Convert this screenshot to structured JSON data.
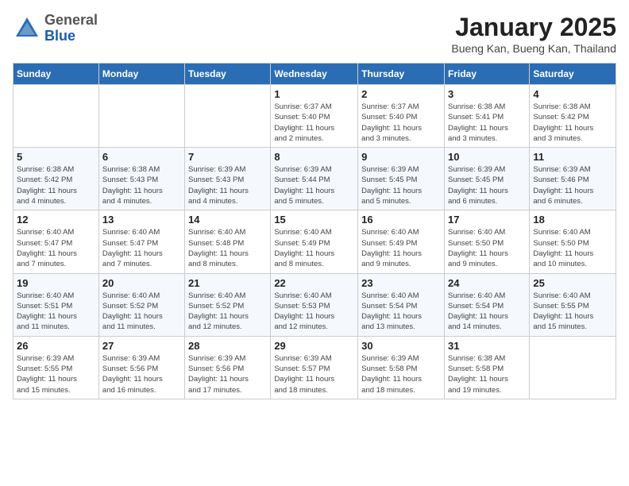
{
  "header": {
    "logo_general": "General",
    "logo_blue": "Blue",
    "month_title": "January 2025",
    "location": "Bueng Kan, Bueng Kan, Thailand"
  },
  "weekdays": [
    "Sunday",
    "Monday",
    "Tuesday",
    "Wednesday",
    "Thursday",
    "Friday",
    "Saturday"
  ],
  "weeks": [
    [
      {
        "day": "",
        "info": ""
      },
      {
        "day": "",
        "info": ""
      },
      {
        "day": "",
        "info": ""
      },
      {
        "day": "1",
        "info": "Sunrise: 6:37 AM\nSunset: 5:40 PM\nDaylight: 11 hours\nand 2 minutes."
      },
      {
        "day": "2",
        "info": "Sunrise: 6:37 AM\nSunset: 5:40 PM\nDaylight: 11 hours\nand 3 minutes."
      },
      {
        "day": "3",
        "info": "Sunrise: 6:38 AM\nSunset: 5:41 PM\nDaylight: 11 hours\nand 3 minutes."
      },
      {
        "day": "4",
        "info": "Sunrise: 6:38 AM\nSunset: 5:42 PM\nDaylight: 11 hours\nand 3 minutes."
      }
    ],
    [
      {
        "day": "5",
        "info": "Sunrise: 6:38 AM\nSunset: 5:42 PM\nDaylight: 11 hours\nand 4 minutes."
      },
      {
        "day": "6",
        "info": "Sunrise: 6:38 AM\nSunset: 5:43 PM\nDaylight: 11 hours\nand 4 minutes."
      },
      {
        "day": "7",
        "info": "Sunrise: 6:39 AM\nSunset: 5:43 PM\nDaylight: 11 hours\nand 4 minutes."
      },
      {
        "day": "8",
        "info": "Sunrise: 6:39 AM\nSunset: 5:44 PM\nDaylight: 11 hours\nand 5 minutes."
      },
      {
        "day": "9",
        "info": "Sunrise: 6:39 AM\nSunset: 5:45 PM\nDaylight: 11 hours\nand 5 minutes."
      },
      {
        "day": "10",
        "info": "Sunrise: 6:39 AM\nSunset: 5:45 PM\nDaylight: 11 hours\nand 6 minutes."
      },
      {
        "day": "11",
        "info": "Sunrise: 6:39 AM\nSunset: 5:46 PM\nDaylight: 11 hours\nand 6 minutes."
      }
    ],
    [
      {
        "day": "12",
        "info": "Sunrise: 6:40 AM\nSunset: 5:47 PM\nDaylight: 11 hours\nand 7 minutes."
      },
      {
        "day": "13",
        "info": "Sunrise: 6:40 AM\nSunset: 5:47 PM\nDaylight: 11 hours\nand 7 minutes."
      },
      {
        "day": "14",
        "info": "Sunrise: 6:40 AM\nSunset: 5:48 PM\nDaylight: 11 hours\nand 8 minutes."
      },
      {
        "day": "15",
        "info": "Sunrise: 6:40 AM\nSunset: 5:49 PM\nDaylight: 11 hours\nand 8 minutes."
      },
      {
        "day": "16",
        "info": "Sunrise: 6:40 AM\nSunset: 5:49 PM\nDaylight: 11 hours\nand 9 minutes."
      },
      {
        "day": "17",
        "info": "Sunrise: 6:40 AM\nSunset: 5:50 PM\nDaylight: 11 hours\nand 9 minutes."
      },
      {
        "day": "18",
        "info": "Sunrise: 6:40 AM\nSunset: 5:50 PM\nDaylight: 11 hours\nand 10 minutes."
      }
    ],
    [
      {
        "day": "19",
        "info": "Sunrise: 6:40 AM\nSunset: 5:51 PM\nDaylight: 11 hours\nand 11 minutes."
      },
      {
        "day": "20",
        "info": "Sunrise: 6:40 AM\nSunset: 5:52 PM\nDaylight: 11 hours\nand 11 minutes."
      },
      {
        "day": "21",
        "info": "Sunrise: 6:40 AM\nSunset: 5:52 PM\nDaylight: 11 hours\nand 12 minutes."
      },
      {
        "day": "22",
        "info": "Sunrise: 6:40 AM\nSunset: 5:53 PM\nDaylight: 11 hours\nand 12 minutes."
      },
      {
        "day": "23",
        "info": "Sunrise: 6:40 AM\nSunset: 5:54 PM\nDaylight: 11 hours\nand 13 minutes."
      },
      {
        "day": "24",
        "info": "Sunrise: 6:40 AM\nSunset: 5:54 PM\nDaylight: 11 hours\nand 14 minutes."
      },
      {
        "day": "25",
        "info": "Sunrise: 6:40 AM\nSunset: 5:55 PM\nDaylight: 11 hours\nand 15 minutes."
      }
    ],
    [
      {
        "day": "26",
        "info": "Sunrise: 6:39 AM\nSunset: 5:55 PM\nDaylight: 11 hours\nand 15 minutes."
      },
      {
        "day": "27",
        "info": "Sunrise: 6:39 AM\nSunset: 5:56 PM\nDaylight: 11 hours\nand 16 minutes."
      },
      {
        "day": "28",
        "info": "Sunrise: 6:39 AM\nSunset: 5:56 PM\nDaylight: 11 hours\nand 17 minutes."
      },
      {
        "day": "29",
        "info": "Sunrise: 6:39 AM\nSunset: 5:57 PM\nDaylight: 11 hours\nand 18 minutes."
      },
      {
        "day": "30",
        "info": "Sunrise: 6:39 AM\nSunset: 5:58 PM\nDaylight: 11 hours\nand 18 minutes."
      },
      {
        "day": "31",
        "info": "Sunrise: 6:38 AM\nSunset: 5:58 PM\nDaylight: 11 hours\nand 19 minutes."
      },
      {
        "day": "",
        "info": ""
      }
    ]
  ]
}
